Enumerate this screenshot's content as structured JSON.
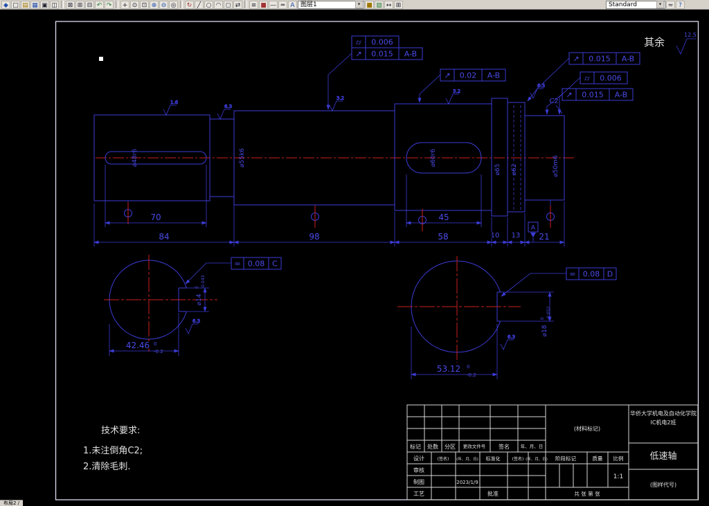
{
  "toolbar": {
    "layer_combo": "图层1",
    "style_combo": "Standard",
    "dropdown_glyph": "▾",
    "icons": [
      {
        "name": "app",
        "glyph": "◆"
      },
      {
        "name": "new",
        "glyph": "□"
      },
      {
        "name": "open",
        "glyph": "▤"
      },
      {
        "name": "save",
        "glyph": "▦"
      },
      {
        "name": "print",
        "glyph": "▣"
      },
      {
        "name": "preview",
        "glyph": "◫"
      },
      {
        "name": "cut",
        "glyph": "⊠"
      },
      {
        "name": "copy",
        "glyph": "⊞"
      },
      {
        "name": "paste",
        "glyph": "⊟"
      },
      {
        "name": "undo",
        "glyph": "↶"
      },
      {
        "name": "redo",
        "glyph": "↷"
      },
      {
        "name": "pan",
        "glyph": "+"
      },
      {
        "name": "zoom-realtime",
        "glyph": "⊙"
      },
      {
        "name": "zoom-window",
        "glyph": "⊡"
      },
      {
        "name": "zoom-in",
        "glyph": "⊕"
      },
      {
        "name": "zoom-out",
        "glyph": "⊖"
      },
      {
        "name": "zoom-extents",
        "glyph": "◎"
      },
      {
        "name": "regen",
        "glyph": "↻"
      },
      {
        "name": "line",
        "glyph": "╱"
      },
      {
        "name": "circle",
        "glyph": "○"
      },
      {
        "name": "arc",
        "glyph": "◠"
      },
      {
        "name": "erase",
        "glyph": "◻"
      },
      {
        "name": "move",
        "glyph": "⇄"
      },
      {
        "name": "layers",
        "glyph": "≡"
      },
      {
        "name": "layer-color",
        "glyph": "■"
      },
      {
        "name": "linetype",
        "glyph": "—"
      },
      {
        "name": "lineweight",
        "glyph": "═"
      },
      {
        "name": "text-style",
        "glyph": "A"
      },
      {
        "name": "color-swatch",
        "glyph": "■"
      },
      {
        "name": "hatch",
        "glyph": "▨"
      },
      {
        "name": "dimension",
        "glyph": "↔"
      },
      {
        "name": "table",
        "glyph": "⊞"
      },
      {
        "name": "match-properties",
        "glyph": "≈"
      },
      {
        "name": "help",
        "glyph": "?"
      }
    ]
  },
  "status": {
    "tab": "布局2 /"
  },
  "drawing": {
    "surface_note": {
      "label": "其余",
      "value": "12.5"
    },
    "dims": {
      "key_len_left": "70",
      "seg1": "84",
      "seg2": "98",
      "key_len_right": "45",
      "seg3": "58",
      "seg4": "10",
      "seg5": "13",
      "seg6": "21"
    },
    "dia": {
      "d1": "⌀48r6",
      "d2": "⌀55k6",
      "d3": "⌀60r6",
      "d4": "⌀65",
      "d5": "⌀62",
      "d6": "⌀50m6"
    },
    "chamfer": "C2",
    "datum_a": "A",
    "frames": {
      "f1": {
        "sym": "⌭",
        "val": "0.006"
      },
      "f2": {
        "sym": "↗",
        "val": "0.015",
        "datum": "A-B"
      },
      "f3": {
        "sym": "↗",
        "val": "0.02",
        "datum": "A-B"
      },
      "f4": {
        "sym": "↗",
        "val": "0.015",
        "datum": "A-B"
      },
      "f5": {
        "sym": "⌭",
        "val": "0.006"
      },
      "f6": {
        "sym": "↗",
        "val": "0.015",
        "datum": "A-B"
      },
      "f7": {
        "sym": "=",
        "val": "0.08",
        "datum": "C"
      },
      "f8": {
        "sym": "=",
        "val": "0.08",
        "datum": "D"
      }
    },
    "section_a": {
      "width": "42.46",
      "tol_top": "0",
      "tol_bot": "-0.2",
      "key": "⌀14",
      "key_tol_top": "0",
      "key_tol_bot": "-0.043"
    },
    "section_b": {
      "width": "53.12",
      "tol_top": "0",
      "tol_bot": "-0.2",
      "key": "⌀18",
      "key_tol_top": "0",
      "key_tol_bot": "-0.052"
    },
    "roughness": {
      "r1": "1.6",
      "r2": "6.3",
      "r3": "3.2",
      "r4": "3.2",
      "r5": "6.3",
      "r6": "6.3",
      "r7": "6.3"
    },
    "tech": {
      "title": "技术要求:",
      "item1": "1.未注倒角C2;",
      "item2": "2.清除毛刺."
    }
  },
  "titleblock": {
    "school_line1": "华侨大学机电及自动化学院",
    "school_line2": "IC机电2班",
    "part_name": "低速轴",
    "drawing_no": "(图样代号)",
    "material": "(材料标记)",
    "header": [
      "标记",
      "处数",
      "分区",
      "更改文件号",
      "签名",
      "年、月、日"
    ],
    "rows": {
      "design": "设计",
      "draft": "制图",
      "check": "审核",
      "process": "工艺",
      "standard": "标准化",
      "approve": "批准",
      "sign": "(签名)",
      "date": "(年、月、日)",
      "date_value": "2023/1/9"
    },
    "stage": "阶段标记",
    "mass": "质量",
    "scale_label": "比例",
    "scale": "1:1",
    "sheets": "共 张 第 张"
  }
}
